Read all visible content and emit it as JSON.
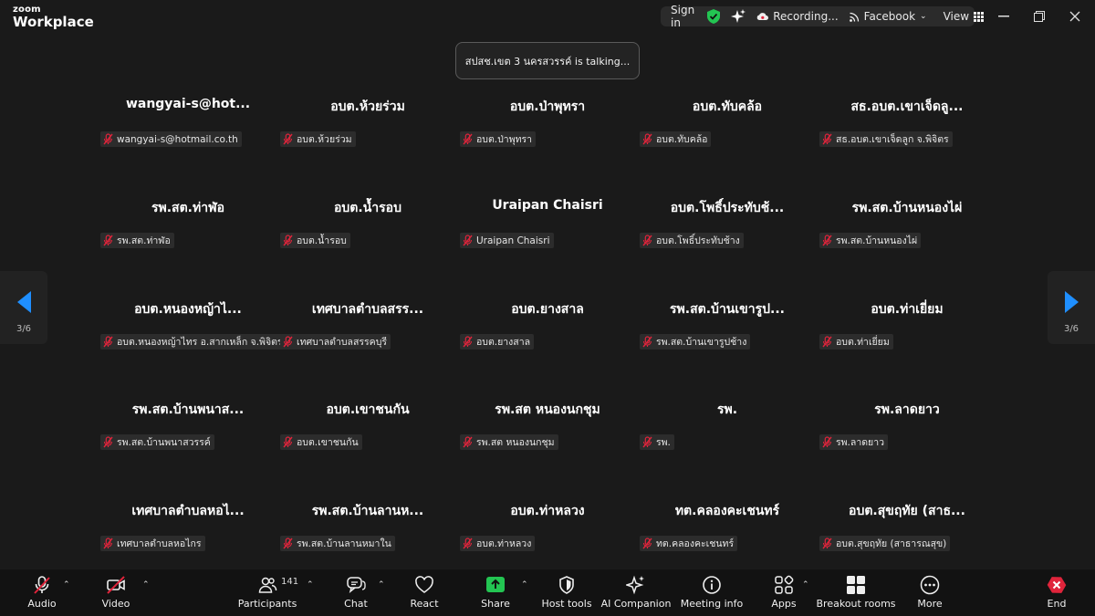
{
  "app": {
    "brand_top": "zoom",
    "brand_bottom": "Workplace"
  },
  "titlebar": {
    "signin_label": "Sign in",
    "recording_label": "Recording...",
    "stream_label": "Facebook",
    "view_label": "View"
  },
  "toast": {
    "text": "สปสช.เขต 3 นครสวรรค์ is talking..."
  },
  "pager": {
    "left_page": "3/6",
    "right_page": "3/6"
  },
  "participants": [
    {
      "name": "wangyai-s@hot...",
      "tag": "wangyai-s@hotmail.co.th"
    },
    {
      "name": "อบต.ห้วยร่วม",
      "tag": "อบต.ห้วยร่วม"
    },
    {
      "name": "อบต.ป่าพุทรา",
      "tag": "อบต.ป่าพุทรา"
    },
    {
      "name": "อบต.ทับคล้อ",
      "tag": "อบต.ทับคล้อ"
    },
    {
      "name": "สธ.อบต.เขาเจ็ดลู...",
      "tag": "สธ.อบต.เขาเจ็ดลูก จ.พิจิตร"
    },
    {
      "name": "รพ.สต.ท่าฬ่อ",
      "tag": "รพ.สต.ท่าฬ่อ"
    },
    {
      "name": "อบต.น้ำรอบ",
      "tag": "อบต.น้ำรอบ"
    },
    {
      "name": "Uraipan Chaisri",
      "tag": "Uraipan Chaisri"
    },
    {
      "name": "อบต.โพธิ์ประทับช้...",
      "tag": "อบต.โพธิ์ประทับช้าง"
    },
    {
      "name": "รพ.สต.บ้านหนองไผ่",
      "tag": "รพ.สต.บ้านหนองไผ่"
    },
    {
      "name": "อบต.หนองหญ้าไ...",
      "tag": "อบต.หนองหญ้าไทร อ.สากเหล็ก จ.พิจิตร"
    },
    {
      "name": "เทศบาลตำบลสรร...",
      "tag": "เทศบาลตำบลสรรคบุรี"
    },
    {
      "name": "อบต.ยางสาล",
      "tag": "อบต.ยางสาล"
    },
    {
      "name": "รพ.สต.บ้านเขารูป...",
      "tag": "รพ.สต.บ้านเขารูปช้าง"
    },
    {
      "name": "อบต.ท่าเยี่ยม",
      "tag": "อบต.ท่าเยี่ยม"
    },
    {
      "name": "รพ.สต.บ้านพนาส...",
      "tag": "รพ.สต.บ้านพนาสวรรค์"
    },
    {
      "name": "อบต.เขาชนกัน",
      "tag": "อบต.เขาชนกัน"
    },
    {
      "name": "รพ.สต หนองนกชุม",
      "tag": "รพ.สต หนองนกชุม"
    },
    {
      "name": "รพ.",
      "tag": "รพ."
    },
    {
      "name": "รพ.ลาดยาว",
      "tag": "รพ.ลาดยาว"
    },
    {
      "name": "เทศบาลตำบลหอไ...",
      "tag": "เทศบาลตำบลหอไกร"
    },
    {
      "name": "รพ.สต.บ้านลานห...",
      "tag": "รพ.สต.บ้านลานหมาใน"
    },
    {
      "name": "อบต.ท่าหลวง",
      "tag": "อบต.ท่าหลวง"
    },
    {
      "name": "ทต.คลองคะเชนทร์",
      "tag": "ทต.คลองคะเชนทร์"
    },
    {
      "name": "อบต.สุขฤทัย (สาธ...",
      "tag": "อบต.สุขฤทัย (สาธารณสุข)"
    }
  ],
  "toolbar": {
    "audio": "Audio",
    "video": "Video",
    "participants": "Participants",
    "participants_count": "141",
    "chat": "Chat",
    "react": "React",
    "share": "Share",
    "host_tools": "Host tools",
    "ai_companion": "AI Companion",
    "meeting_info": "Meeting info",
    "apps": "Apps",
    "breakout_rooms": "Breakout rooms",
    "more": "More",
    "end": "End"
  },
  "colors": {
    "accent": "#1f8fff",
    "share_green": "#23c552",
    "muted_red": "#e0243b",
    "end_red": "#e0243b"
  }
}
